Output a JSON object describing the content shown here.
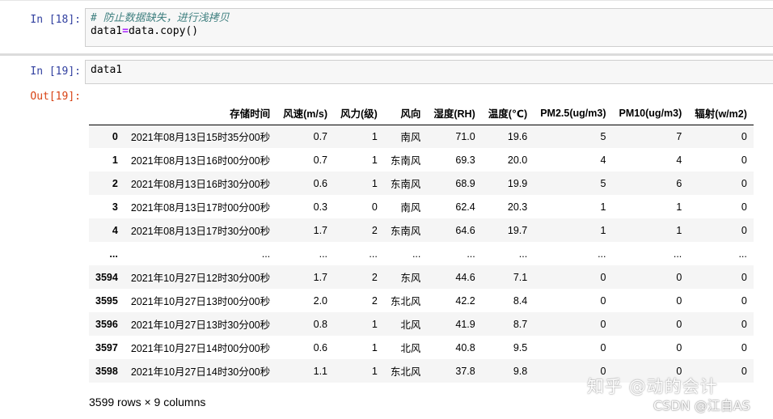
{
  "cell18": {
    "prompt": "In  [18]:",
    "comment": "# 防止数据缺失，进行浅拷贝",
    "code_lhs": "data1",
    "code_op": "=",
    "code_rhs": "data.copy()"
  },
  "cell19": {
    "prompt": "In  [19]:",
    "code": "data1",
    "out_prompt": "Out[19]:"
  },
  "table": {
    "columns": [
      "存储时间",
      "风速(m/s)",
      "风力(级)",
      "风向",
      "湿度(RH)",
      "温度(℃)",
      "PM2.5(ug/m3)",
      "PM10(ug/m3)",
      "辐射(w/m2)"
    ],
    "rows": [
      {
        "index": "0",
        "cells": [
          "2021年08月13日15时35分00秒",
          "0.7",
          "1",
          "南风",
          "71.0",
          "19.6",
          "5",
          "7",
          "0"
        ]
      },
      {
        "index": "1",
        "cells": [
          "2021年08月13日16时00分00秒",
          "0.7",
          "1",
          "东南风",
          "69.3",
          "20.0",
          "4",
          "4",
          "0"
        ]
      },
      {
        "index": "2",
        "cells": [
          "2021年08月13日16时30分00秒",
          "0.6",
          "1",
          "东南风",
          "68.9",
          "19.9",
          "5",
          "6",
          "0"
        ]
      },
      {
        "index": "3",
        "cells": [
          "2021年08月13日17时00分00秒",
          "0.3",
          "0",
          "南风",
          "62.4",
          "20.3",
          "1",
          "1",
          "0"
        ]
      },
      {
        "index": "4",
        "cells": [
          "2021年08月13日17时30分00秒",
          "1.7",
          "2",
          "东南风",
          "64.6",
          "19.7",
          "1",
          "1",
          "0"
        ]
      },
      {
        "index": "...",
        "cells": [
          "...",
          "...",
          "...",
          "...",
          "...",
          "...",
          "...",
          "...",
          "..."
        ]
      },
      {
        "index": "3594",
        "cells": [
          "2021年10月27日12时30分00秒",
          "1.7",
          "2",
          "东风",
          "44.6",
          "7.1",
          "0",
          "0",
          "0"
        ]
      },
      {
        "index": "3595",
        "cells": [
          "2021年10月27日13时00分00秒",
          "2.0",
          "2",
          "东北风",
          "42.2",
          "8.4",
          "0",
          "0",
          "0"
        ]
      },
      {
        "index": "3596",
        "cells": [
          "2021年10月27日13时30分00秒",
          "0.8",
          "1",
          "北风",
          "41.9",
          "8.7",
          "0",
          "0",
          "0"
        ]
      },
      {
        "index": "3597",
        "cells": [
          "2021年10月27日14时00分00秒",
          "0.6",
          "1",
          "北风",
          "40.8",
          "9.5",
          "0",
          "0",
          "0"
        ]
      },
      {
        "index": "3598",
        "cells": [
          "2021年10月27日14时30分00秒",
          "1.1",
          "1",
          "东北风",
          "37.8",
          "9.8",
          "0",
          "0",
          "0"
        ]
      }
    ]
  },
  "shape_info": "3599 rows × 9 columns",
  "watermark": {
    "line1": "知乎 @动的会计",
    "line2": "CSDN @江自AS"
  }
}
